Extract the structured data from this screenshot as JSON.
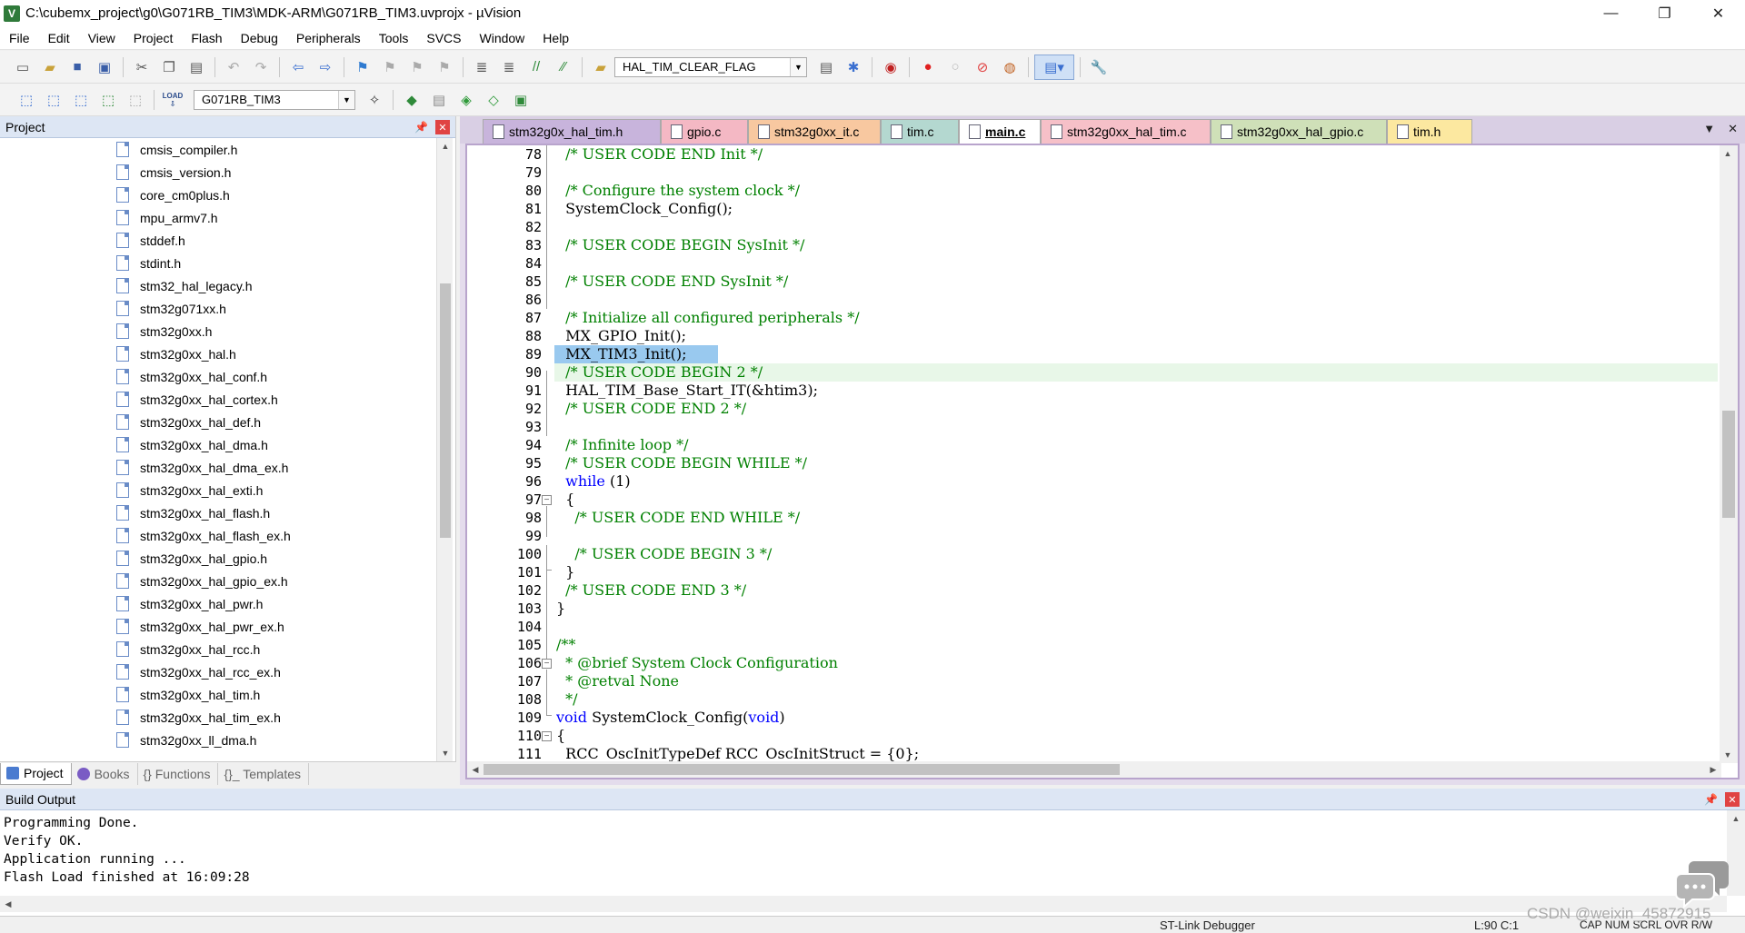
{
  "window": {
    "title": "C:\\cubemx_project\\g0\\G071RB_TIM3\\MDK-ARM\\G071RB_TIM3.uvprojx - µVision",
    "app_icon": "V",
    "minimize": "—",
    "maximize": "❐",
    "close": "✕"
  },
  "menu": [
    "File",
    "Edit",
    "View",
    "Project",
    "Flash",
    "Debug",
    "Peripherals",
    "Tools",
    "SVCS",
    "Window",
    "Help"
  ],
  "toolbar1": {
    "find_combo_value": "HAL_TIM_CLEAR_FLAG",
    "icons": [
      "new-file-icon",
      "open-icon",
      "save-icon",
      "save-all-icon",
      "cut-icon",
      "copy-icon",
      "paste-icon",
      "undo-icon",
      "redo-icon",
      "back-icon",
      "forward-icon",
      "bookmark-icon",
      "prev-bookmark-icon",
      "next-bookmark-icon",
      "clear-bookmarks-icon",
      "indent-icon",
      "unindent-icon",
      "comment-icon",
      "uncomment-icon",
      "find-in-files-icon",
      "find-icon",
      "incremental-find-icon",
      "debug-session-icon",
      "breakpoint-icon",
      "disable-breakpoint-icon",
      "kill-breakpoints-icon",
      "window-layout-icon",
      "configure-icon"
    ]
  },
  "toolbar2": {
    "target_combo_value": "G071RB_TIM3",
    "load_label": "LOAD"
  },
  "project_panel": {
    "title": "Project",
    "files": [
      "cmsis_compiler.h",
      "cmsis_version.h",
      "core_cm0plus.h",
      "mpu_armv7.h",
      "stddef.h",
      "stdint.h",
      "stm32_hal_legacy.h",
      "stm32g071xx.h",
      "stm32g0xx.h",
      "stm32g0xx_hal.h",
      "stm32g0xx_hal_conf.h",
      "stm32g0xx_hal_cortex.h",
      "stm32g0xx_hal_def.h",
      "stm32g0xx_hal_dma.h",
      "stm32g0xx_hal_dma_ex.h",
      "stm32g0xx_hal_exti.h",
      "stm32g0xx_hal_flash.h",
      "stm32g0xx_hal_flash_ex.h",
      "stm32g0xx_hal_gpio.h",
      "stm32g0xx_hal_gpio_ex.h",
      "stm32g0xx_hal_pwr.h",
      "stm32g0xx_hal_pwr_ex.h",
      "stm32g0xx_hal_rcc.h",
      "stm32g0xx_hal_rcc_ex.h",
      "stm32g0xx_hal_tim.h",
      "stm32g0xx_hal_tim_ex.h",
      "stm32g0xx_ll_dma.h"
    ],
    "tabs": [
      {
        "label": "Project",
        "color": "#4a7bd0"
      },
      {
        "label": "Books",
        "color": "#7a5cc4"
      },
      {
        "label": "{} Functions",
        "color": ""
      },
      {
        "label": "{}_ Templates",
        "color": ""
      }
    ]
  },
  "editor": {
    "tabs": [
      {
        "label": "stm32g0x_hal_tim.h",
        "color": "#c8b4dc",
        "active": false
      },
      {
        "label": "gpio.c",
        "color": "#f4b8c4",
        "active": false
      },
      {
        "label": "stm32g0xx_it.c",
        "color": "#f8c8a0",
        "active": false
      },
      {
        "label": "tim.c",
        "color": "#b4d8d0",
        "active": false
      },
      {
        "label": "main.c",
        "color": "#ffffff",
        "active": true
      },
      {
        "label": "stm32g0xx_hal_tim.c",
        "color": "#f6c0c8",
        "active": false
      },
      {
        "label": "stm32g0xx_hal_gpio.c",
        "color": "#cfe0b8",
        "active": false
      },
      {
        "label": "tim.h",
        "color": "#fce8a0",
        "active": false
      }
    ],
    "tab_menu": "▼",
    "tab_close": "✕",
    "lines": [
      {
        "n": "78",
        "text": "  /* USER CODE END Init */",
        "kind": "cm"
      },
      {
        "n": "79",
        "text": "",
        "kind": ""
      },
      {
        "n": "80",
        "text": "  /* Configure the system clock */",
        "kind": "cm"
      },
      {
        "n": "81",
        "text": "  SystemClock_Config();",
        "kind": ""
      },
      {
        "n": "82",
        "text": "",
        "kind": ""
      },
      {
        "n": "83",
        "text": "  /* USER CODE BEGIN SysInit */",
        "kind": "cm"
      },
      {
        "n": "84",
        "text": "",
        "kind": ""
      },
      {
        "n": "85",
        "text": "  /* USER CODE END SysInit */",
        "kind": "cm"
      },
      {
        "n": "86",
        "text": "",
        "kind": ""
      },
      {
        "n": "87",
        "text": "  /* Initialize all configured peripherals */",
        "kind": "cm"
      },
      {
        "n": "88",
        "text": "  MX_GPIO_Init();",
        "kind": ""
      },
      {
        "n": "89",
        "text": "  MX_TIM3_Init();",
        "kind": "sel"
      },
      {
        "n": "90",
        "text": "  /* USER CODE BEGIN 2 */",
        "kind": "cm"
      },
      {
        "n": "91",
        "text": "  HAL_TIM_Base_Start_IT(&htim3);",
        "kind": ""
      },
      {
        "n": "92",
        "text": "  /* USER CODE END 2 */",
        "kind": "cm"
      },
      {
        "n": "93",
        "text": "",
        "kind": ""
      },
      {
        "n": "94",
        "text": "  /* Infinite loop */",
        "kind": "cm"
      },
      {
        "n": "95",
        "text": "  /* USER CODE BEGIN WHILE */",
        "kind": "cm"
      },
      {
        "n": "96",
        "text": "  while (1)",
        "kind": "kw"
      },
      {
        "n": "97",
        "text": "  {",
        "kind": ""
      },
      {
        "n": "98",
        "text": "    /* USER CODE END WHILE */",
        "kind": "cm"
      },
      {
        "n": "99",
        "text": "",
        "kind": ""
      },
      {
        "n": "100",
        "text": "    /* USER CODE BEGIN 3 */",
        "kind": "cm"
      },
      {
        "n": "101",
        "text": "  }",
        "kind": ""
      },
      {
        "n": "102",
        "text": "  /* USER CODE END 3 */",
        "kind": "cm"
      },
      {
        "n": "103",
        "text": "}",
        "kind": ""
      },
      {
        "n": "104",
        "text": "",
        "kind": ""
      },
      {
        "n": "105",
        "text": "/**",
        "kind": "cm"
      },
      {
        "n": "106",
        "text": "  * @brief System Clock Configuration",
        "kind": "cm"
      },
      {
        "n": "107",
        "text": "  * @retval None",
        "kind": "cm"
      },
      {
        "n": "108",
        "text": "  */",
        "kind": "cm"
      },
      {
        "n": "109",
        "text": "void SystemClock_Config(void)",
        "kind": "fn"
      },
      {
        "n": "110",
        "text": "{",
        "kind": ""
      },
      {
        "n": "111",
        "text": "  RCC_OscInitTypeDef RCC_OscInitStruct = {0};",
        "kind": ""
      }
    ]
  },
  "build_output": {
    "title": "Build Output",
    "lines": [
      "Programming Done.",
      "Verify OK.",
      "Application running ...",
      "Flash Load finished at 16:09:28"
    ]
  },
  "status": {
    "debugger": "ST-Link Debugger",
    "position": "L:90 C:1",
    "indicators": "CAP NUM SCRL OVR R/W"
  },
  "watermark": "CSDN @weixin_45872915"
}
